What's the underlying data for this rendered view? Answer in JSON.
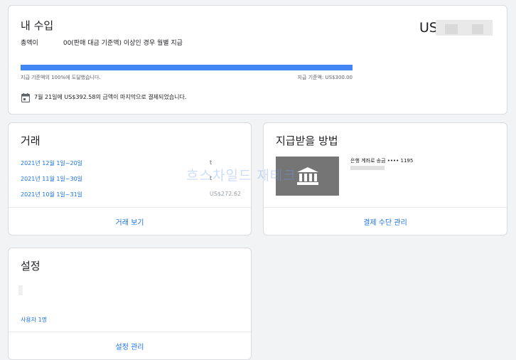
{
  "earnings": {
    "title": "내 수입",
    "amount_visible": "US",
    "threshold_text_prefix": "총액이",
    "threshold_text_suffix": "00(판매 대금 기준액) 이상인 경우 월별 지급",
    "progress_fraction": 1.0,
    "progress_left_label": "지급 기준액의 100%에 도달했습니다.",
    "progress_right_label": "지급 기준액: US$300.00",
    "last_payment_text": "7월 21일에 US$392.58의 금액이 마지막으로 결제되었습니다.",
    "calendar_icon": "calendar-icon"
  },
  "transactions": {
    "title": "거래",
    "rows": [
      {
        "period": "2021년 12월 1일~20일",
        "amount": "t"
      },
      {
        "period": "2021년 11월 1일~30일",
        "amount": "t"
      },
      {
        "period": "2021년 10월 1일~31일",
        "amount": "US$272.62"
      }
    ],
    "footer_label": "거래 보기"
  },
  "payment_method": {
    "title": "지급받을 방법",
    "bank_label": "은행 계좌로 송금 •••• 1195",
    "bank_icon": "bank-icon",
    "footer_label": "결제 수단 관리",
    "watermark": "흐스차일드 재테크"
  },
  "settings": {
    "title": "설정",
    "users_label": "사용자 1명",
    "footer_label": "설정 관리"
  }
}
